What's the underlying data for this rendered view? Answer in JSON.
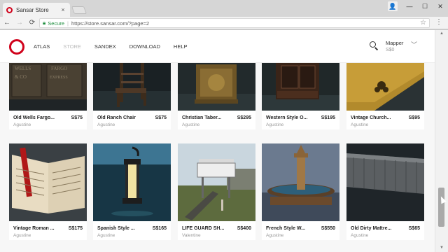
{
  "browser": {
    "tab_title": "Sansar Store",
    "tab_close": "×",
    "secure_label": "Secure",
    "url": "https://store.sansar.com/?page=2",
    "window_minimize": "—",
    "window_maximize": "☐",
    "window_close": "✕"
  },
  "nav": {
    "links": [
      "ATLAS",
      "STORE",
      "SANDEX",
      "DOWNLOAD",
      "HELP"
    ],
    "active_link": "STORE",
    "username": "Mapper",
    "balance": "S$0"
  },
  "products": [
    {
      "name": "Old Wells Fargo...",
      "price": "S$75",
      "creator": "Agustine"
    },
    {
      "name": "Old Ranch Chair",
      "price": "S$75",
      "creator": "Agustine"
    },
    {
      "name": "Christian Taber...",
      "price": "S$295",
      "creator": "Agustine"
    },
    {
      "name": "Western Style O...",
      "price": "S$195",
      "creator": "Agustine"
    },
    {
      "name": "Vintage Church...",
      "price": "S$95",
      "creator": "Agustine"
    },
    {
      "name": "Vintage Roman ...",
      "price": "S$175",
      "creator": "Agustine"
    },
    {
      "name": "Spanish Style ...",
      "price": "S$165",
      "creator": "Agustine"
    },
    {
      "name": "LIFE GUARD SH...",
      "price": "S$400",
      "creator": "Valentine"
    },
    {
      "name": "French Style W...",
      "price": "S$550",
      "creator": "Agustine"
    },
    {
      "name": "Old Dirty Mattre...",
      "price": "S$65",
      "creator": "Agustine"
    }
  ],
  "colors": {
    "brand_red": "#d0021b",
    "secure_green": "#1e8e3e"
  }
}
